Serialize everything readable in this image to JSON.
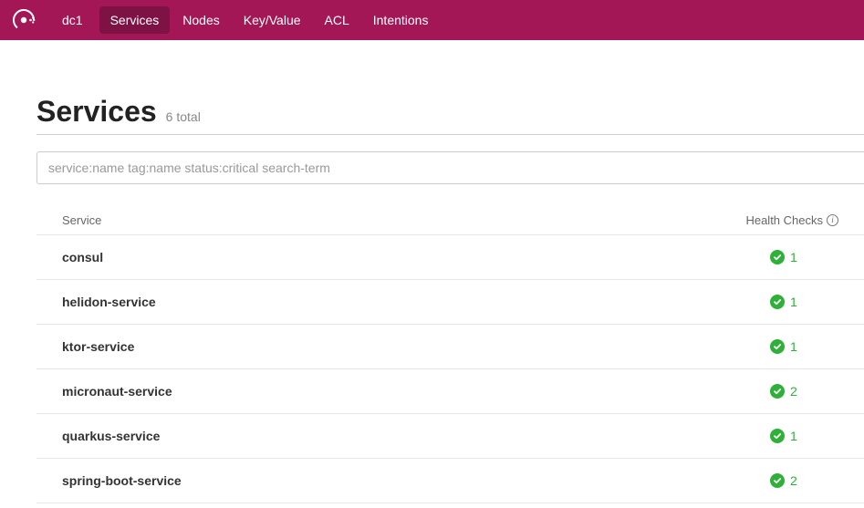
{
  "nav": {
    "dc": "dc1",
    "items": [
      {
        "label": "Services",
        "active": true
      },
      {
        "label": "Nodes",
        "active": false
      },
      {
        "label": "Key/Value",
        "active": false
      },
      {
        "label": "ACL",
        "active": false
      },
      {
        "label": "Intentions",
        "active": false
      }
    ]
  },
  "page": {
    "title": "Services",
    "subtitle": "6 total",
    "search_placeholder": "service:name tag:name status:critical search-term"
  },
  "table": {
    "col_service": "Service",
    "col_health": "Health Checks",
    "rows": [
      {
        "name": "consul",
        "passing": 1
      },
      {
        "name": "helidon-service",
        "passing": 1
      },
      {
        "name": "ktor-service",
        "passing": 1
      },
      {
        "name": "micronaut-service",
        "passing": 2
      },
      {
        "name": "quarkus-service",
        "passing": 1
      },
      {
        "name": "spring-boot-service",
        "passing": 2
      }
    ]
  }
}
